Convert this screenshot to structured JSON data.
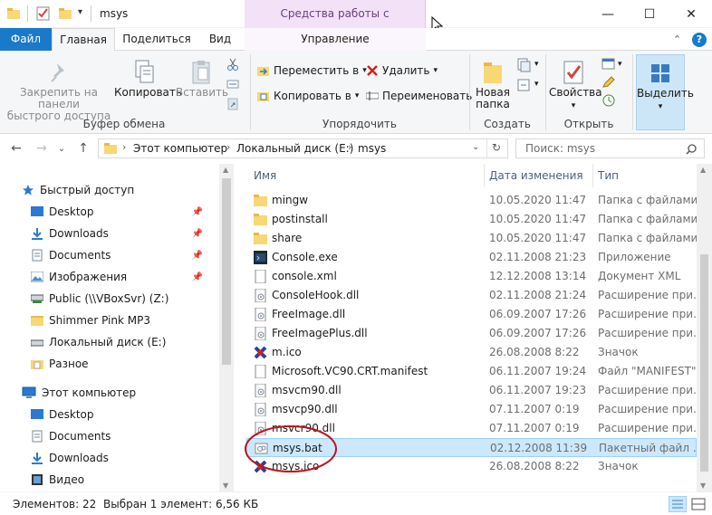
{
  "window": {
    "title": "msys",
    "context_tab_banner": "Средства работы с приложениями",
    "minimize": "—",
    "maximize": "☐",
    "close": "✕"
  },
  "tabs": [
    {
      "label": "Файл"
    },
    {
      "label": "Главная"
    },
    {
      "label": "Поделиться"
    },
    {
      "label": "Вид"
    },
    {
      "label": "Управление"
    }
  ],
  "ribbon": {
    "clipboard": {
      "pin_label": "Закрепить на панели быстрого доступа",
      "pin_line1": "Закрепить на панели",
      "pin_line2": "быстрого доступа",
      "copy": "Копировать",
      "paste": "Вставить",
      "group": "Буфер обмена"
    },
    "organize": {
      "move_to": "Переместить в",
      "copy_to": "Копировать в",
      "delete": "Удалить",
      "rename": "Переименовать",
      "group": "Упорядочить"
    },
    "create": {
      "new_folder_line1": "Новая",
      "new_folder_line2": "папка",
      "group": "Создать"
    },
    "open": {
      "properties": "Свойства",
      "group": "Открыть"
    },
    "select": {
      "select": "Выделить"
    }
  },
  "address": {
    "crumbs": [
      "Этот компьютер",
      "Локальный диск (E:)",
      "msys"
    ],
    "search_placeholder": "Поиск: msys"
  },
  "nav": {
    "quick_access": "Быстрый доступ",
    "items": [
      {
        "label": "Desktop",
        "pinned": true
      },
      {
        "label": "Downloads",
        "pinned": true
      },
      {
        "label": "Documents",
        "pinned": true
      },
      {
        "label": "Изображения",
        "pinned": true
      },
      {
        "label": "Public (\\\\VBoxSvr) (Z:)",
        "pinned": false
      },
      {
        "label": "Shimmer Pink MP3",
        "pinned": false
      },
      {
        "label": "Локальный диск (E:)",
        "pinned": false
      },
      {
        "label": "Разное",
        "pinned": false
      }
    ],
    "this_pc": "Этот компьютер",
    "pc_items": [
      {
        "label": "Desktop"
      },
      {
        "label": "Documents"
      },
      {
        "label": "Downloads"
      },
      {
        "label": "Видео"
      }
    ]
  },
  "columns": {
    "name": "Имя",
    "date": "Дата изменения",
    "type": "Тип"
  },
  "files": [
    {
      "name": "mingw",
      "date": "10.05.2020 11:47",
      "type": "Папка с файлами",
      "icon": "folder"
    },
    {
      "name": "postinstall",
      "date": "10.05.2020 11:47",
      "type": "Папка с файлами",
      "icon": "folder"
    },
    {
      "name": "share",
      "date": "10.05.2020 11:47",
      "type": "Папка с файлами",
      "icon": "folder"
    },
    {
      "name": "Console.exe",
      "date": "02.11.2008 21:23",
      "type": "Приложение",
      "icon": "exe"
    },
    {
      "name": "console.xml",
      "date": "12.12.2008 13:14",
      "type": "Документ XML",
      "icon": "doc"
    },
    {
      "name": "ConsoleHook.dll",
      "date": "02.11.2008 21:24",
      "type": "Расширение при...",
      "icon": "dll"
    },
    {
      "name": "FreeImage.dll",
      "date": "06.09.2007 17:26",
      "type": "Расширение при...",
      "icon": "dll"
    },
    {
      "name": "FreeImagePlus.dll",
      "date": "06.09.2007 17:26",
      "type": "Расширение при...",
      "icon": "dll"
    },
    {
      "name": "m.ico",
      "date": "26.08.2008 8:22",
      "type": "Значок",
      "icon": "ico"
    },
    {
      "name": "Microsoft.VC90.CRT.manifest",
      "date": "06.11.2007 19:24",
      "type": "Файл \"MANIFEST\"",
      "icon": "doc"
    },
    {
      "name": "msvcm90.dll",
      "date": "06.11.2007 19:23",
      "type": "Расширение при...",
      "icon": "dll"
    },
    {
      "name": "msvcp90.dll",
      "date": "07.11.2007 0:19",
      "type": "Расширение при...",
      "icon": "dll"
    },
    {
      "name": "msvcr90.dll",
      "date": "07.11.2007 0:19",
      "type": "Расширение при...",
      "icon": "dll"
    },
    {
      "name": "msys.bat",
      "date": "02.12.2008 11:39",
      "type": "Пакетный файл ...",
      "icon": "bat",
      "selected": true
    },
    {
      "name": "msys.ico",
      "date": "26.08.2008 8:22",
      "type": "Значок",
      "icon": "ico"
    }
  ],
  "status": {
    "count": "Элементов: 22",
    "selection": "Выбран 1 элемент: 6,56 КБ"
  },
  "colors": {
    "file_tab": "#1979ca",
    "selection": "#cce8ff",
    "annotation_circle": "#c0141b"
  }
}
